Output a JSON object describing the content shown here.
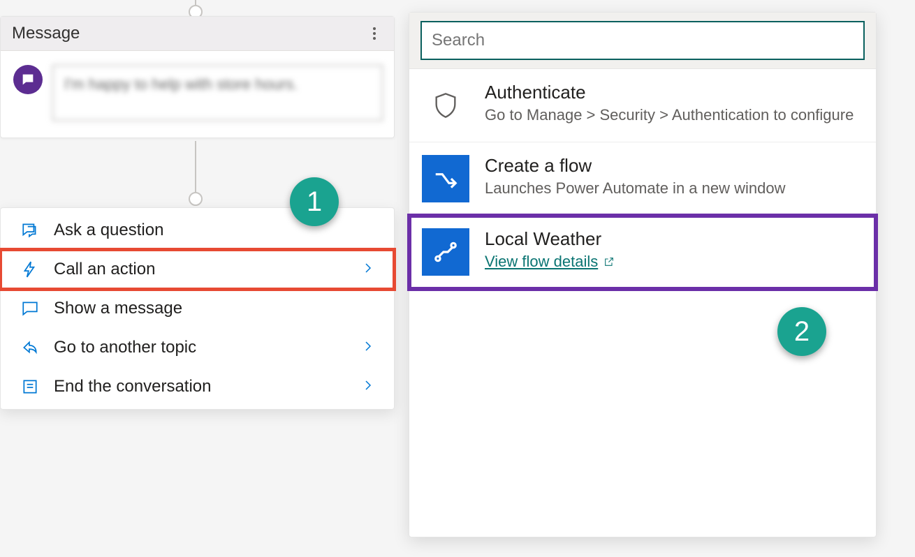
{
  "message_node": {
    "title": "Message",
    "body_text": "I'm happy to help with store hours."
  },
  "menu": {
    "items": [
      {
        "label": "Ask a question",
        "has_chevron": false
      },
      {
        "label": "Call an action",
        "has_chevron": true,
        "highlight": true
      },
      {
        "label": "Show a message",
        "has_chevron": false
      },
      {
        "label": "Go to another topic",
        "has_chevron": true
      },
      {
        "label": "End the conversation",
        "has_chevron": true
      }
    ]
  },
  "action_panel": {
    "search_placeholder": "Search",
    "items": [
      {
        "title": "Authenticate",
        "sub": "Go to Manage > Security > Authentication to configure",
        "icon": "shield"
      },
      {
        "title": "Create a flow",
        "sub": "Launches Power Automate in a new window",
        "icon": "flow-create"
      },
      {
        "title": "Local Weather",
        "link": "View flow details",
        "icon": "flow",
        "highlight": true
      }
    ]
  },
  "badges": {
    "b1": "1",
    "b2": "2"
  }
}
